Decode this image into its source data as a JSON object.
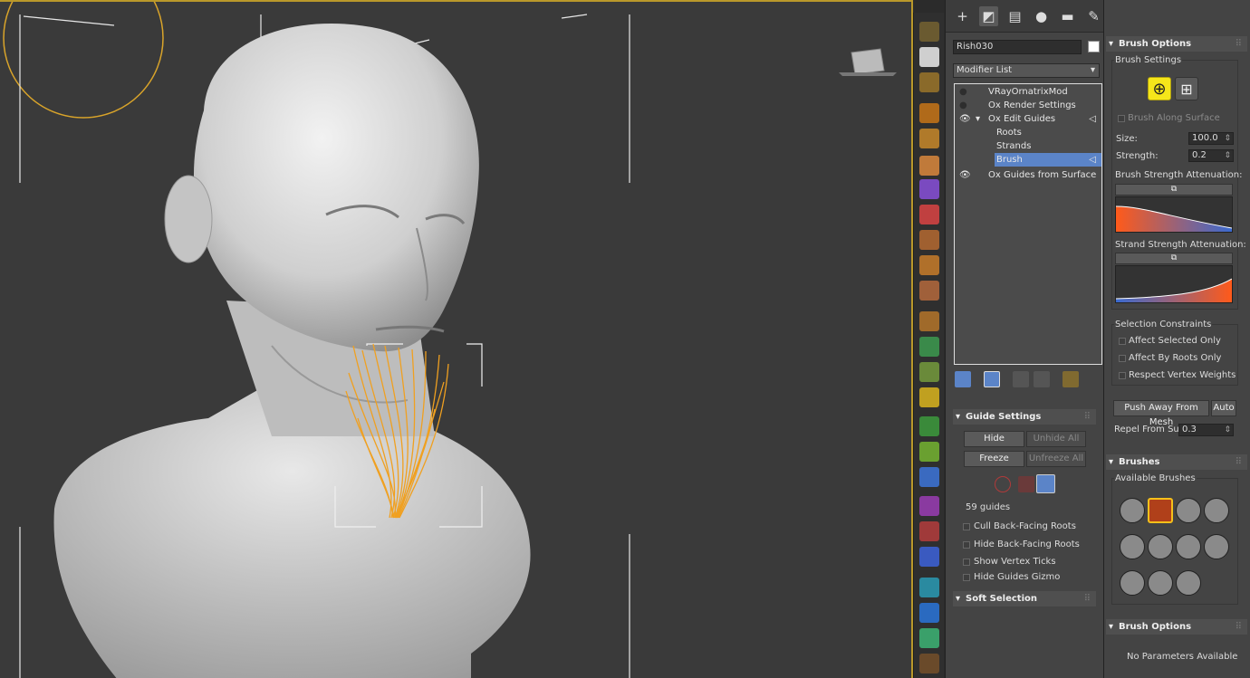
{
  "command_panel": {
    "tabs": [
      "create-tab-icon",
      "modify-tab-icon",
      "hierarchy-tab-icon",
      "motion-tab-icon",
      "display-tab-icon",
      "utilities-tab-icon"
    ],
    "object_name": "Rish030",
    "modifier_list_label": "Modifier List",
    "stack": [
      {
        "label": "VRayOrnatrixMod"
      },
      {
        "label": "Ox Render Settings"
      },
      {
        "label": "Ox Edit Guides"
      },
      {
        "label": "Roots"
      },
      {
        "label": "Strands"
      },
      {
        "label": "Brush",
        "selected": true
      },
      {
        "label": "Ox Guides from Surface"
      }
    ],
    "guide_settings": {
      "title": "Guide Settings",
      "hide": "Hide",
      "unhide_all": "Unhide All",
      "freeze": "Freeze",
      "unfreeze_all": "Unfreeze All",
      "guide_count": "59 guides",
      "options": [
        "Cull Back-Facing Roots",
        "Hide Back-Facing Roots",
        "Show Vertex Ticks",
        "Hide Guides Gizmo"
      ]
    },
    "soft_selection": {
      "title": "Soft Selection"
    }
  },
  "brush_options": {
    "title": "Brush Options",
    "settings_label": "Brush Settings",
    "brush_along_surface": "Brush Along Surface",
    "size_label": "Size:",
    "size_value": "100.0",
    "strength_label": "Strength:",
    "strength_value": "0.2",
    "brush_atten_label": "Brush Strength Attenuation:",
    "strand_atten_label": "Strand Strength Attenuation:",
    "selection_constraints": {
      "title": "Selection Constraints",
      "options": [
        "Affect Selected Only",
        "Affect By Roots Only",
        "Respect Vertex Weights"
      ]
    },
    "push_away": "Push Away From Mesh",
    "auto": "Auto",
    "repel_label": "Repel From Surf.:",
    "repel_value": "0.3"
  },
  "brushes": {
    "title": "Brushes",
    "available_label": "Available Brushes"
  },
  "brush_options_2": {
    "title": "Brush Options",
    "empty_label": "No Parameters Available"
  },
  "colors": {
    "selection": "#5b84c8",
    "accent_yellow": "#f5e61a",
    "hair_orange": "#f0a020",
    "viewport_border": "#b9982a"
  }
}
